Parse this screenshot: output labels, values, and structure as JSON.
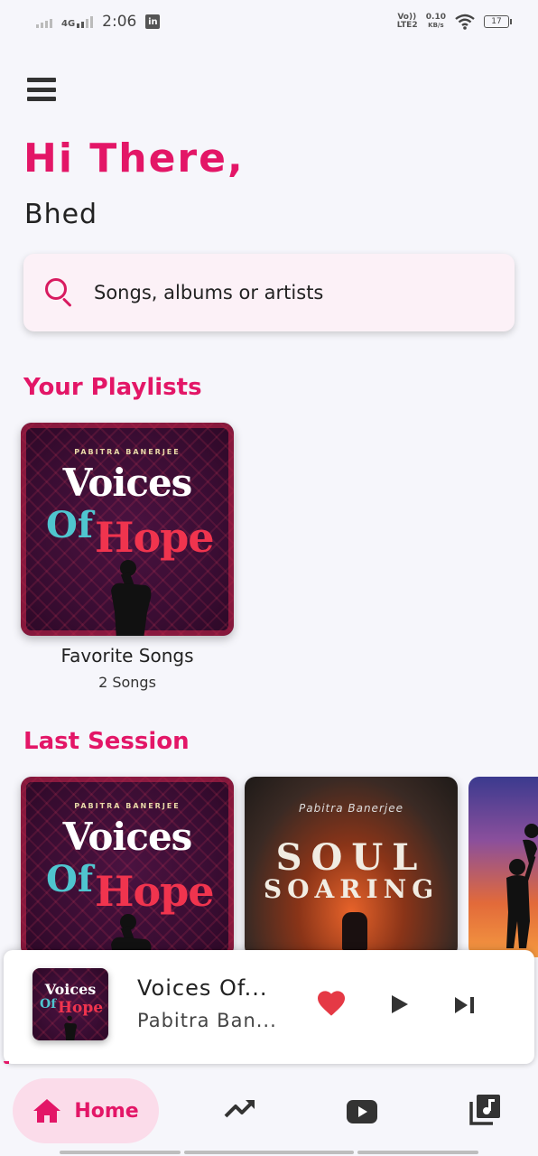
{
  "status_bar": {
    "network": "4G",
    "time": "2:06",
    "linkedin_icon": "linkedin-icon",
    "volte": "Vo)) LTE2",
    "speed_value": "0.10",
    "speed_unit": "KB/s",
    "battery": "17"
  },
  "header": {
    "greeting": "Hi There,",
    "username": "Bhed"
  },
  "search": {
    "placeholder": "Songs, albums or artists"
  },
  "playlists": {
    "title": "Your Playlists",
    "items": [
      {
        "title": "Favorite Songs",
        "count": "2 Songs",
        "cover": {
          "artist": "PABITRA BANERJEE",
          "line1": "Voices",
          "line2a": "Of",
          "line2b": "Hope"
        }
      }
    ]
  },
  "last_session": {
    "title": "Last Session",
    "items": [
      {
        "cover": {
          "artist": "PABITRA BANERJEE",
          "line1": "Voices",
          "line2a": "Of",
          "line2b": "Hope"
        }
      },
      {
        "cover": {
          "artist": "Pabitra Banerjee",
          "line1": "SOUL",
          "line2": "SOARING"
        }
      },
      {
        "cover": {}
      }
    ]
  },
  "now_playing": {
    "title": "Voices Of...",
    "artist": "Pabitra Ban...",
    "cover": {
      "line1": "Voices",
      "line2a": "Of",
      "line2b": "Hope"
    },
    "liked": true,
    "progress": 0.01
  },
  "bottom_nav": {
    "items": [
      {
        "label": "Home",
        "icon": "home-icon",
        "active": true
      },
      {
        "label": "",
        "icon": "trending-icon",
        "active": false
      },
      {
        "label": "",
        "icon": "youtube-icon",
        "active": false
      },
      {
        "label": "",
        "icon": "music-library-icon",
        "active": false
      }
    ]
  },
  "colors": {
    "accent": "#e31667",
    "background": "#f6f6fb",
    "search_bg": "#fcf1f7",
    "nav_active_bg": "#fbdcea"
  }
}
